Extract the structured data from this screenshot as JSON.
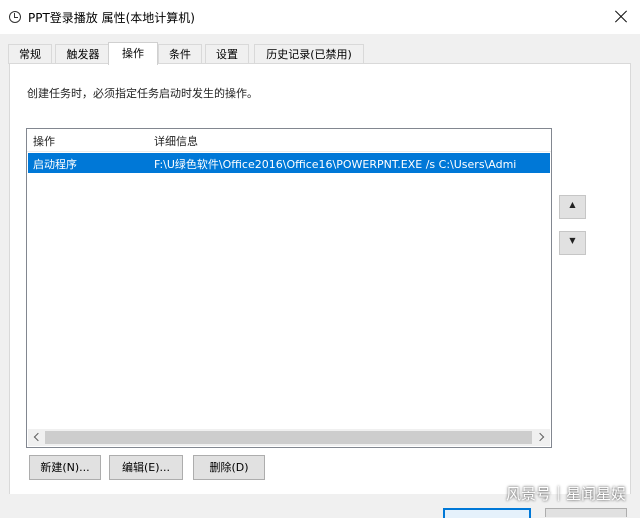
{
  "window": {
    "title": "PPT登录播放 属性(本地计算机)"
  },
  "tabs": [
    {
      "label": "常规"
    },
    {
      "label": "触发器"
    },
    {
      "label": "操作"
    },
    {
      "label": "条件"
    },
    {
      "label": "设置"
    },
    {
      "label": "历史记录(已禁用)"
    }
  ],
  "active_tab": "操作",
  "description": "创建任务时，必须指定任务启动时发生的操作。",
  "list": {
    "columns": [
      "操作",
      "详细信息"
    ],
    "rows": [
      {
        "action": "启动程序",
        "details": "F:\\U绿色软件\\Office2016\\Office16\\POWERPNT.EXE /s C:\\Users\\Admi"
      }
    ]
  },
  "buttons": {
    "new": "新建(N)...",
    "edit": "编辑(E)...",
    "delete": "删除(D)"
  },
  "move_buttons": {
    "up": "▲",
    "down": "▼"
  },
  "watermark": "风景号｜星闻星娱",
  "colors": {
    "selection": "#0078d7",
    "panel": "#ffffff",
    "chrome": "#f0f0f0"
  }
}
